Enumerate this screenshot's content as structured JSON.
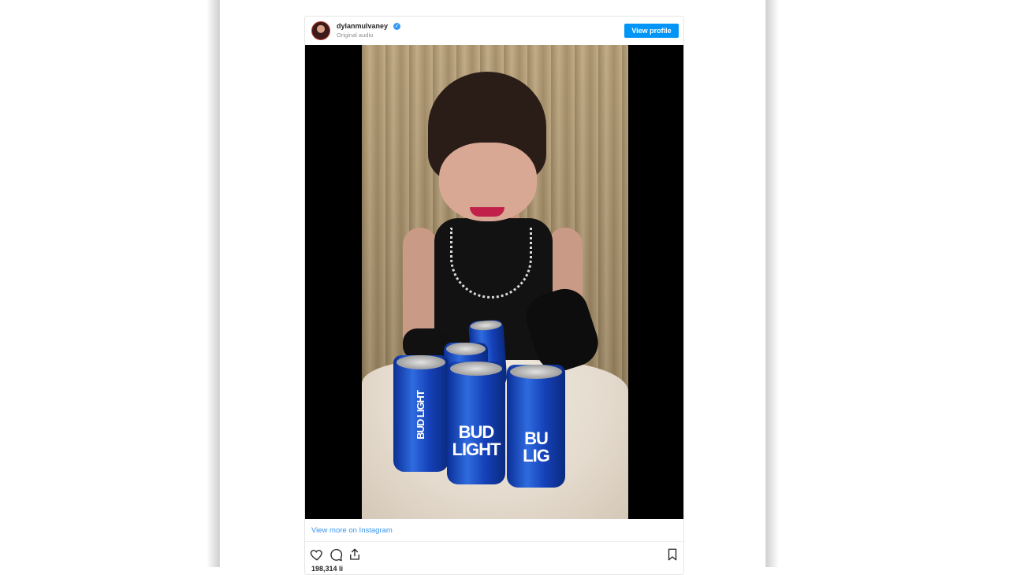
{
  "post": {
    "username": "dylanmulvaney",
    "subtitle": "Original audio",
    "view_profile_label": "View profile",
    "view_more_label": "View more on Instagram",
    "likes_partial": "198,314 li"
  },
  "cans": {
    "side_label": "BUD LIGHT",
    "front_line1": "BUD",
    "front_line2": "LIGHT",
    "right_line1": "BU",
    "right_line2": "LIG"
  },
  "icons": {
    "verified": "verified-badge-icon",
    "like": "heart-icon",
    "comment": "comment-bubble-icon",
    "share": "share-icon",
    "save": "bookmark-icon"
  },
  "colors": {
    "accent": "#0095f6",
    "link": "#3897f0",
    "can_blue": "#1541b8"
  }
}
